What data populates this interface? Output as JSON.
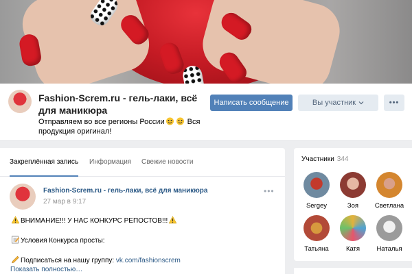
{
  "group": {
    "name": "Fashion-Screm.ru - гель-лаки, всё для маникюра",
    "status_prefix": "Отправляем во все регионы России",
    "status_suffix": "Вся продукция оригинал!"
  },
  "actions": {
    "message_label": "Написать сообщение",
    "member_label": "Вы участник",
    "more_label": "•••"
  },
  "tabs": [
    {
      "label": "Закреплённая запись",
      "active": true
    },
    {
      "label": "Информация",
      "active": false
    },
    {
      "label": "Свежие новости",
      "active": false
    }
  ],
  "post": {
    "author": "Fashion-Screm.ru - гель-лаки, всё для маникюра",
    "date": "27 мар в 9:17",
    "line1": "ВНИМАНИЕ!!! У НАС КОНКУРС РЕПОСТОВ!!!",
    "line2": "Условия Конкурса просты:",
    "line3_prefix": "Подписаться на нашу группу: ",
    "line3_link": "vk.com/fashionscrem",
    "show_more": "Показать полностью…"
  },
  "members": {
    "title": "Участники",
    "count": "344",
    "items": [
      {
        "name": "Sergey"
      },
      {
        "name": "Зоя"
      },
      {
        "name": "Светлана"
      },
      {
        "name": "Татьяна"
      },
      {
        "name": "Катя"
      },
      {
        "name": "Наталья"
      }
    ]
  },
  "colors": {
    "accent": "#5181b8",
    "link": "#2a5885",
    "page_bg": "#edeef0"
  }
}
